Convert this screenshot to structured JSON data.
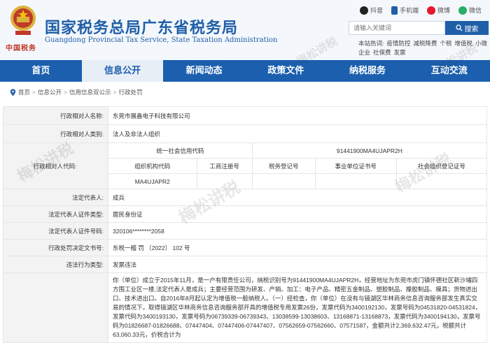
{
  "header": {
    "title": "国家税务总局广东省税务局",
    "subtitle": "Guangdong Provincial Tax Service, State Taxation Administration",
    "emblem_caption": "中国税务"
  },
  "top_links": [
    {
      "label": "抖音",
      "icon": "douyin-icon",
      "color": "#222222"
    },
    {
      "label": "手机端",
      "icon": "mobile-icon",
      "color": "#1f5fa8"
    },
    {
      "label": "微博",
      "icon": "weibo-icon",
      "color": "#e6162d"
    },
    {
      "label": "微信",
      "icon": "wechat-icon",
      "color": "#2aae67"
    }
  ],
  "search": {
    "placeholder": "请输入关键词",
    "button_label": "搜索"
  },
  "hot_words": [
    "本站热词:",
    "疫情防控",
    "减税降费",
    "个税",
    "增值税",
    "小微企业",
    "社保费",
    "发票"
  ],
  "nav": {
    "items": [
      {
        "label": "首页",
        "active": false
      },
      {
        "label": "信息公开",
        "active": true
      },
      {
        "label": "新闻动态",
        "active": false
      },
      {
        "label": "政策文件",
        "active": false
      },
      {
        "label": "纳税服务",
        "active": false
      },
      {
        "label": "互动交流",
        "active": false
      }
    ]
  },
  "breadcrumb": [
    "首页",
    "信息公开",
    "信用信息双公示",
    "行政处罚"
  ],
  "record": {
    "labels": {
      "name": "行政相对人名称:",
      "category": "行政相对人类别:",
      "code": "行政相对人代码:",
      "legal_rep": "法定代表人:",
      "id_type": "法定代表人证件类型:",
      "id_no": "法定代表人证件号码:",
      "doc_no": "行政处罚决定文书号:",
      "violation_type": "违法行为类型:"
    },
    "values": {
      "name": "东莞市展鑫电子科技有限公司",
      "category": "法人及非法人组织",
      "legal_rep": "成兵",
      "id_type": "居民身份证",
      "id_no": "320106********2058",
      "doc_no": "东税一稽 罚 〔2022〕 102 号",
      "violation_type": "发票违法"
    },
    "code_table": {
      "credit_code_label": "统一社会信用代码",
      "credit_code_value": "91441900MA4UJAPR2H",
      "headers": [
        "组织机构代码",
        "工商注册号",
        "税务登记号",
        "事业单位证书号",
        "社会组织登记证号"
      ],
      "org_code_value": "MA4UJAPR2"
    },
    "description": "你（单位）成立于2015年11月，是一户有限责任公司，纳税识别号为91441900MA4UJAPR2H，经营地址为东莞市虎门镇怀德社区新沙埔四方围工业区一楼,法定代表人是成兵；主要经营范围为研发、产销、加工：电子产品、精密五金制品、塑胶制品、橡胶制品、模具；货物进出口、技术进出口。自2016年8月起认定为增值税一般纳税人。（一）经检查，你（单位）在没有与镜湖区华林商务信息咨询服务部发生真实交易的情况下，取得镜湖区华林商务信息咨询服务部开具的增值税专用发票26份，发票代码为3400192130，发票号码为04531820-04531824，发票代码为3400193130，发票号码为06739339-06739343、13038599-13038603、13168871-13168873，发票代码为3400194130，发票号码为01826687-01826688、07447404、07447406-07447407、07562659-07562660、07571587，金额共计2,369,632.47元，税额共计63,060.33元，价税合计为"
  },
  "watermark": "梅松讲税"
}
